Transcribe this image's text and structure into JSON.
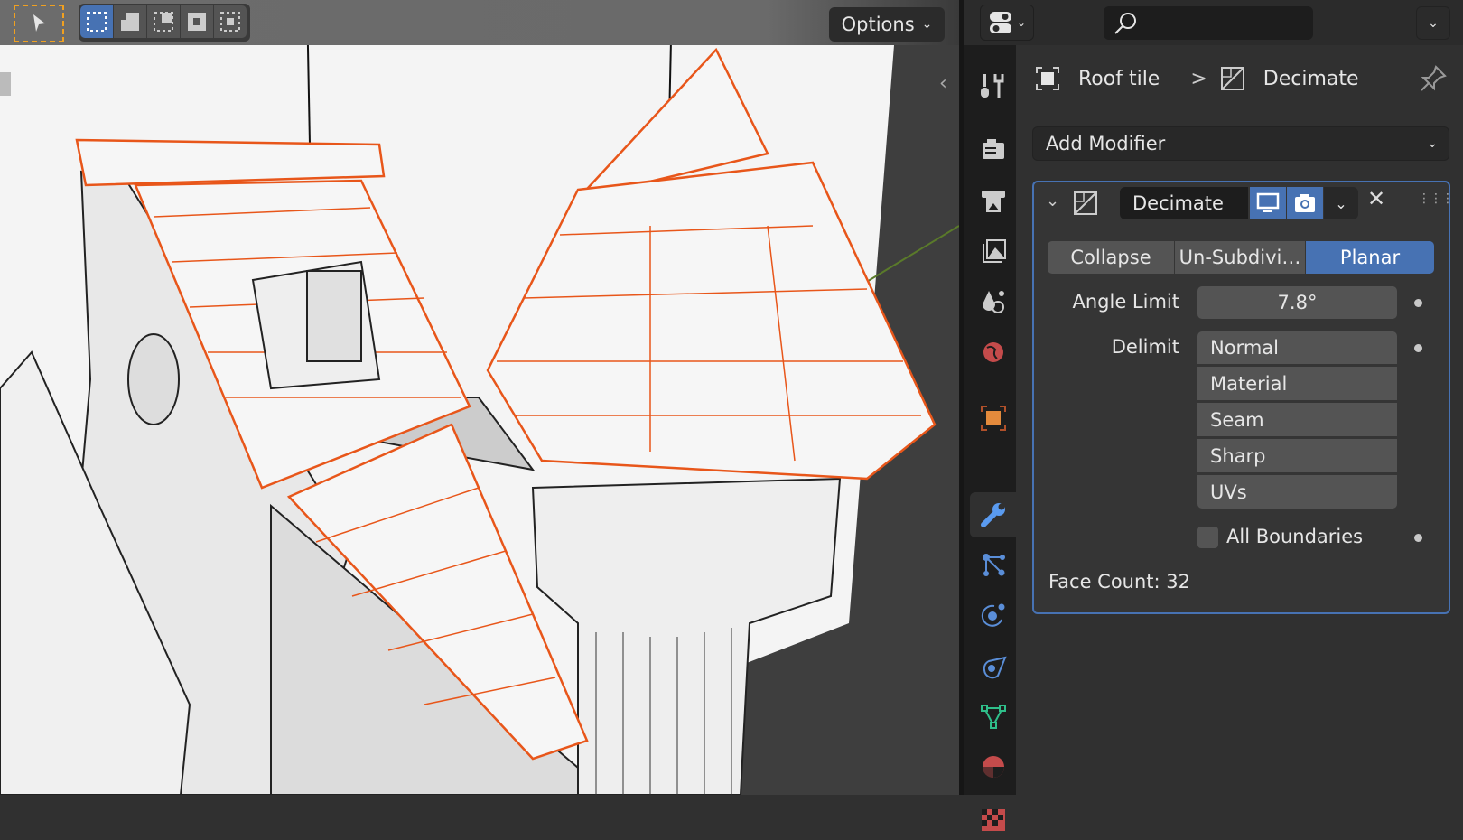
{
  "viewport": {
    "options_label": "Options",
    "tools": [
      "select-cursor",
      "select-box-new",
      "select-extend",
      "select-subtract",
      "select-invert",
      "select-intersect"
    ]
  },
  "properties": {
    "header": {
      "editor_type_icon": "properties-editor-icon",
      "search_placeholder": ""
    },
    "breadcrumb": {
      "object": "Roof tile",
      "separator": ">",
      "modifier": "Decimate"
    },
    "add_modifier_label": "Add Modifier",
    "tabs": [
      "tool",
      "render",
      "output",
      "view-layer",
      "scene",
      "world",
      "object",
      "modifiers",
      "particles",
      "physics",
      "constraints",
      "data",
      "material",
      "texture"
    ],
    "active_tab": "modifiers",
    "modifier": {
      "name": "Decimate",
      "modes": [
        "Collapse",
        "Un-Subdivi…",
        "Planar"
      ],
      "active_mode": "Planar",
      "angle_limit_label": "Angle Limit",
      "angle_limit_value": "7.8°",
      "delimit_label": "Delimit",
      "delimit_options": [
        "Normal",
        "Material",
        "Seam",
        "Sharp",
        "UVs"
      ],
      "all_boundaries_label": "All Boundaries",
      "all_boundaries_checked": false,
      "face_count": "Face Count: 32"
    },
    "colors": {
      "accent": "#4772b3",
      "panel": "#303030",
      "field": "#545454",
      "selection": "#e8561a"
    }
  }
}
